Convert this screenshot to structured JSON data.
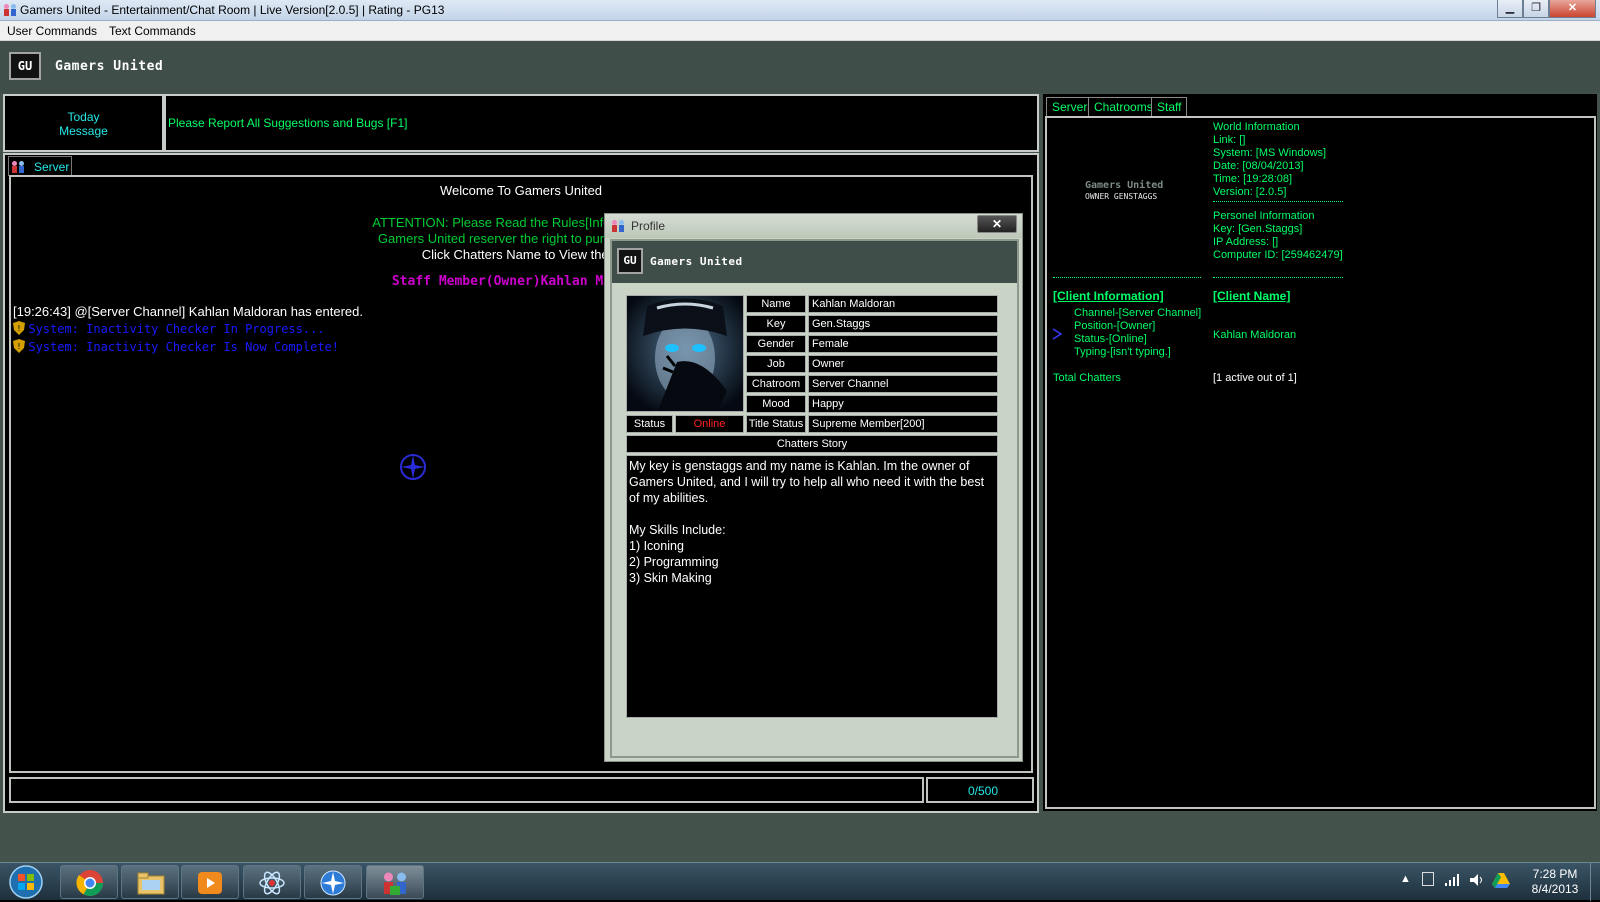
{
  "window": {
    "title": "Gamers United - Entertainment/Chat Room |  Live Version[2.0.5] | Rating  - PG13"
  },
  "menu": {
    "items": [
      "User Commands",
      "Text Commands"
    ]
  },
  "header": {
    "logo": "GU",
    "brand": "Gamers United"
  },
  "today": {
    "label_line1": "Today",
    "label_line2": "Message",
    "message": "Please Report All Suggestions and Bugs [F1]"
  },
  "chat": {
    "tab_label": "Server",
    "welcome": "Welcome To Gamers United",
    "attention1": "ATTENTION: Please Read the Rules[Info]!  Negliger",
    "attention2": "Gamers United reserver the right to punish or ban",
    "click_hint": "Click Chatters Name to View there",
    "staff": "Staff Member(Owner)Kahlan Maldora",
    "entered": "[19:26:43] @[Server Channel] Kahlan Maldoran has entered.",
    "system1": "System: Inactivity Checker In Progress...",
    "system2": "System: Inactivity Checker Is Now Complete!",
    "counter": "0/500"
  },
  "right": {
    "tabs": [
      "Server",
      "Chatrooms",
      "Staff"
    ],
    "logo_line1": "Gamers United",
    "logo_line2": "OWNER GENSTAGGS",
    "world": [
      "World Information",
      "Link: []",
      "System: [MS Windows]",
      "Date: [08/04/2013]",
      "Time: [19:28:08]",
      "Version: [2.0.5]"
    ],
    "personal": [
      "Personel Information",
      "Key: [Gen.Staggs]",
      "IP Address: []",
      "Computer ID: [259462479]"
    ],
    "client_info_header": "[Client Information]",
    "client_name_header": "[Client Name]",
    "client_details": [
      "Channel-[Server Channel]",
      "Position-[Owner]",
      "Status-[Online]",
      "Typing-[isn't typing.]"
    ],
    "client_name": "Kahlan Maldoran",
    "total_label": "Total Chatters",
    "total_value": "[1 active out of 1]"
  },
  "profile": {
    "title": "Profile",
    "close": "✕",
    "logo": "GU",
    "brand": "Gamers United",
    "fields": [
      {
        "label": "Name",
        "value": "Kahlan Maldoran"
      },
      {
        "label": "Key",
        "value": "Gen.Staggs"
      },
      {
        "label": "Gender",
        "value": "Female"
      },
      {
        "label": "Job",
        "value": "Owner"
      },
      {
        "label": "Chatroom",
        "value": "Server Channel"
      },
      {
        "label": "Mood",
        "value": "Happy"
      }
    ],
    "status_label": "Status",
    "status_value": "Online",
    "title_status_label": "Title Status",
    "title_status_value": "Supreme Member[200]",
    "story_label": "Chatters Story",
    "story": [
      "My key is genstaggs and my name is Kahlan. Im the owner of Gamers United, and I will try to help all who need it with the best of my abilities.",
      "",
      "My Skills Include:",
      "1) Iconing",
      "2) Programming",
      "3) Skin Making"
    ]
  },
  "tray": {
    "time": "7:28 PM",
    "date": "8/4/2013"
  },
  "colors": {
    "green": "#00ff66",
    "cyan": "#27e6e6",
    "magenta": "#cc00cc",
    "blue": "#1a1aff",
    "red": "#ff2222"
  }
}
